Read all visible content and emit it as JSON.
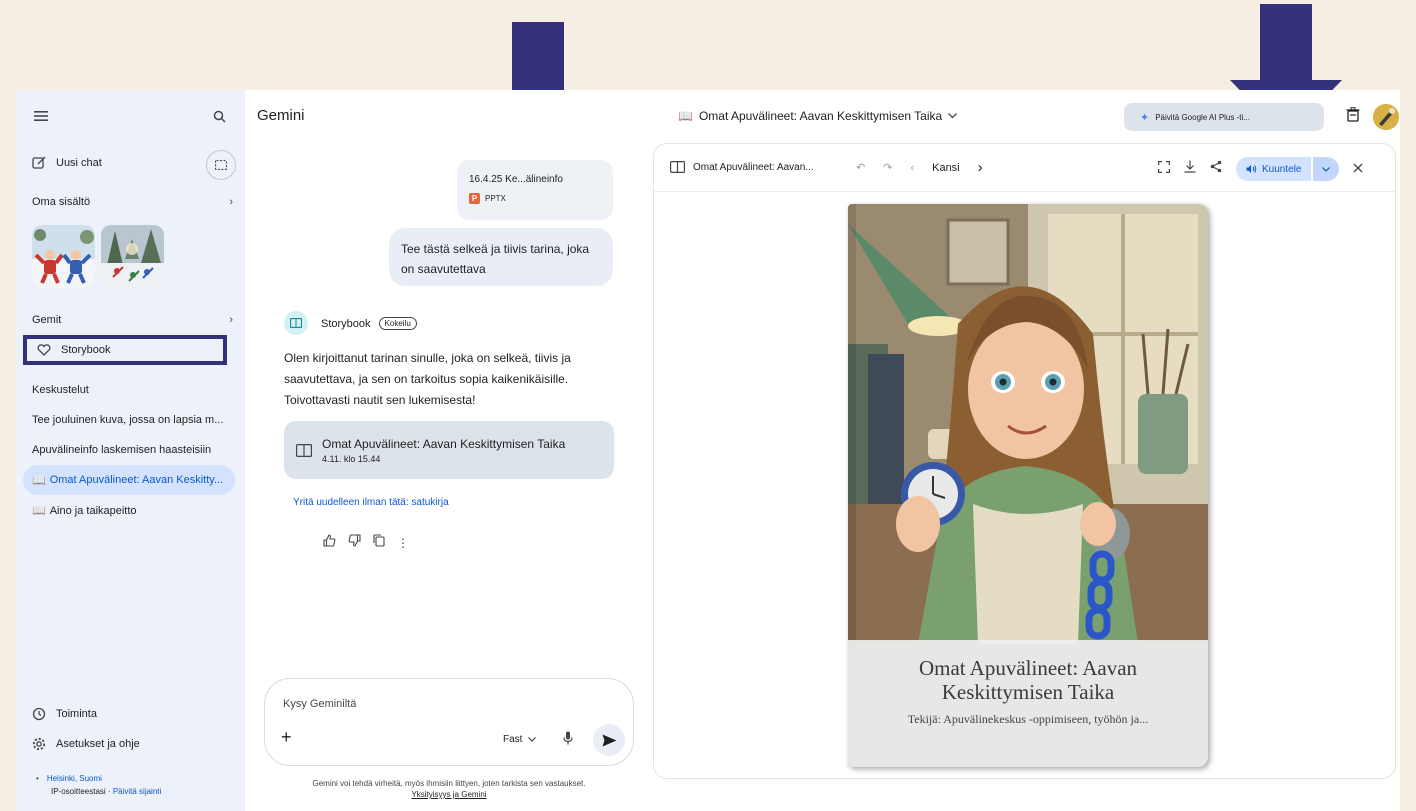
{
  "sidebar": {
    "new_chat": "Uusi chat",
    "own_content": "Oma sisältö",
    "gems": "Gemit",
    "storybook": "Storybook",
    "conversations_header": "Keskustelut",
    "conversations": [
      "Tee jouluinen kuva, jossa on lapsia m...",
      "Apuvälineinfo laskemisen haasteisiin",
      "Omat Apuvälineet: Aavan Keskitty...",
      "Aino ja taikapeitto"
    ],
    "activity": "Toiminta",
    "settings": "Asetukset ja ohje",
    "location": "Helsinki, Suomi",
    "ip_text": "IP-osoitteestasi",
    "update_location": "Päivitä sijainti"
  },
  "chat": {
    "title": "Gemini",
    "file_name": "16.4.25 Ke...älineinfo",
    "file_type": "PPTX",
    "user_message": "Tee tästä selkeä ja tiivis tarina, joka on saavutettava",
    "gem_name": "Storybook",
    "gem_badge": "Kokeilu",
    "answer": "Olen kirjoittanut tarinan sinulle, joka on selkeä, tiivis ja saavutettava, ja sen on tarkoitus sopia kaikenikäisille. Toivottavasti nautit sen lukemisesta!",
    "book_title": "Omat Apuvälineet: Aavan Keskittymisen Taika",
    "book_date": "4.11. klo 15.44",
    "retry": "Yritä uudelleen ilman tätä: satukirja",
    "input_placeholder": "Kysy Geminiltä",
    "mode": "Fast",
    "disclaimer": "Gemini voi tehdä virheitä, myös ihmisiin liittyen, joten tarkista sen vastaukset.",
    "privacy_link": "Yksityisyys ja Gemini"
  },
  "topbar": {
    "doc_title": "Omat Apuvälineet: Aavan Keskittymisen Taika",
    "upgrade": "Päivitä Google AI Plus -ti..."
  },
  "viewer": {
    "title": "Omat Apuvälineet: Aavan...",
    "page": "Kansi",
    "listen": "Kuuntele",
    "cover_title": "Omat Apuvälineet: Aavan Keskittymisen Taika",
    "cover_author": "Tekijä: Apuvälinekeskus -oppimiseen, työhön ja..."
  },
  "colors": {
    "accent": "#0b57d0",
    "arrow": "#33317a",
    "sidebar_bg": "#edf2fa",
    "page_bg": "#f6ede3"
  }
}
